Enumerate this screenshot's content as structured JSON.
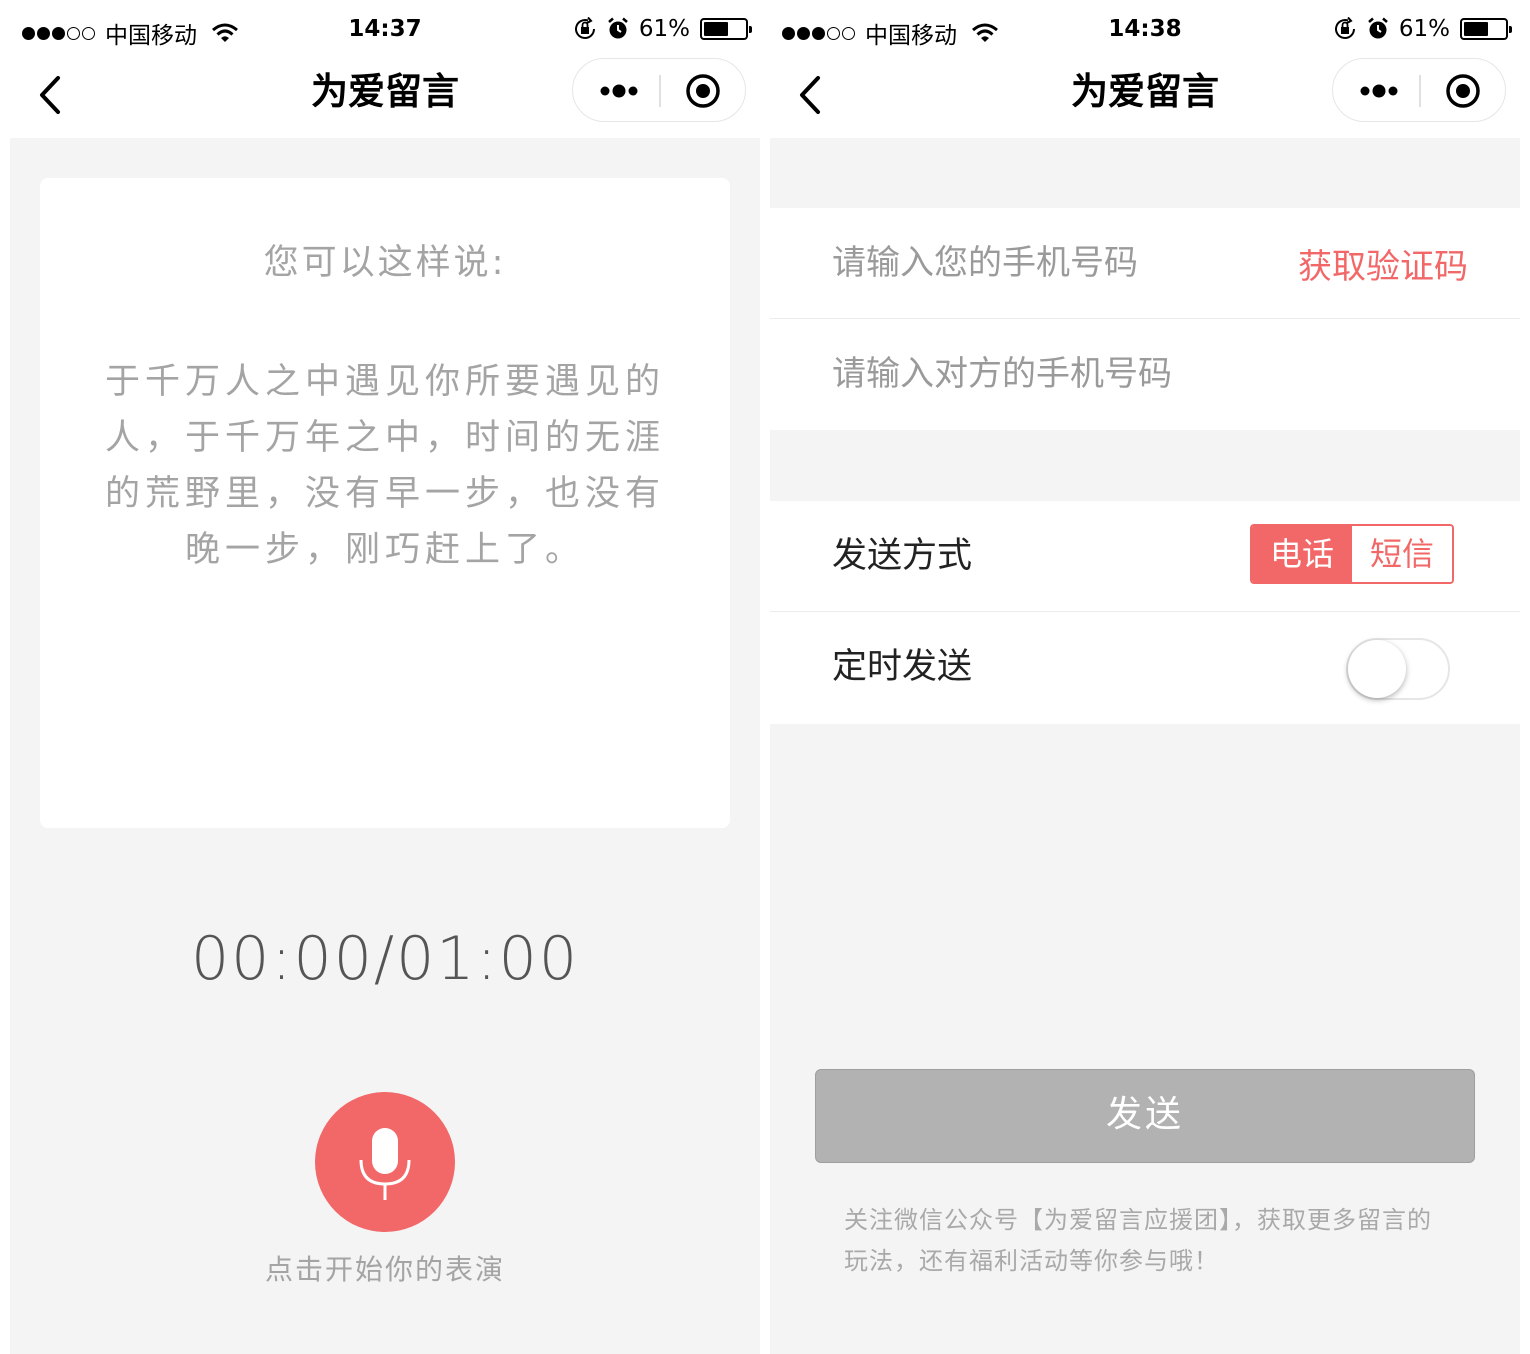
{
  "left": {
    "status_bar": {
      "carrier": "中国移动",
      "time": "14:37",
      "battery_text": "61%",
      "battery_level": 0.61,
      "signal_bars": 3
    },
    "nav": {
      "title": "为爱留言"
    },
    "hint": {
      "title": "您可以这样说:",
      "text": "于千万人之中遇见你所要遇见的人，于千万年之中，时间的无涯的荒野里，没有早一步，也没有晚一步，刚巧赶上了。"
    },
    "timer": "00:00/01:00",
    "mic_caption": "点击开始你的表演"
  },
  "right": {
    "status_bar": {
      "carrier": "中国移动",
      "time": "14:38",
      "battery_text": "61%",
      "battery_level": 0.61,
      "signal_bars": 3
    },
    "nav": {
      "title": "为爱留言"
    },
    "form": {
      "my_phone_placeholder": "请输入您的手机号码",
      "get_code_label": "获取验证码",
      "other_phone_placeholder": "请输入对方的手机号码",
      "send_method_label": "发送方式",
      "send_method_options": [
        "电话",
        "短信"
      ],
      "send_method_selected": "电话",
      "scheduled_label": "定时发送",
      "scheduled_on": false
    },
    "send_button_label": "发送",
    "footer_note": "关注微信公众号【为爱留言应援团】，获取更多留言的玩法，还有福利活动等你参与哦！"
  },
  "colors": {
    "accent": "#f26767",
    "background": "#f4f4f4",
    "disabled_button": "#b2b2b2"
  }
}
